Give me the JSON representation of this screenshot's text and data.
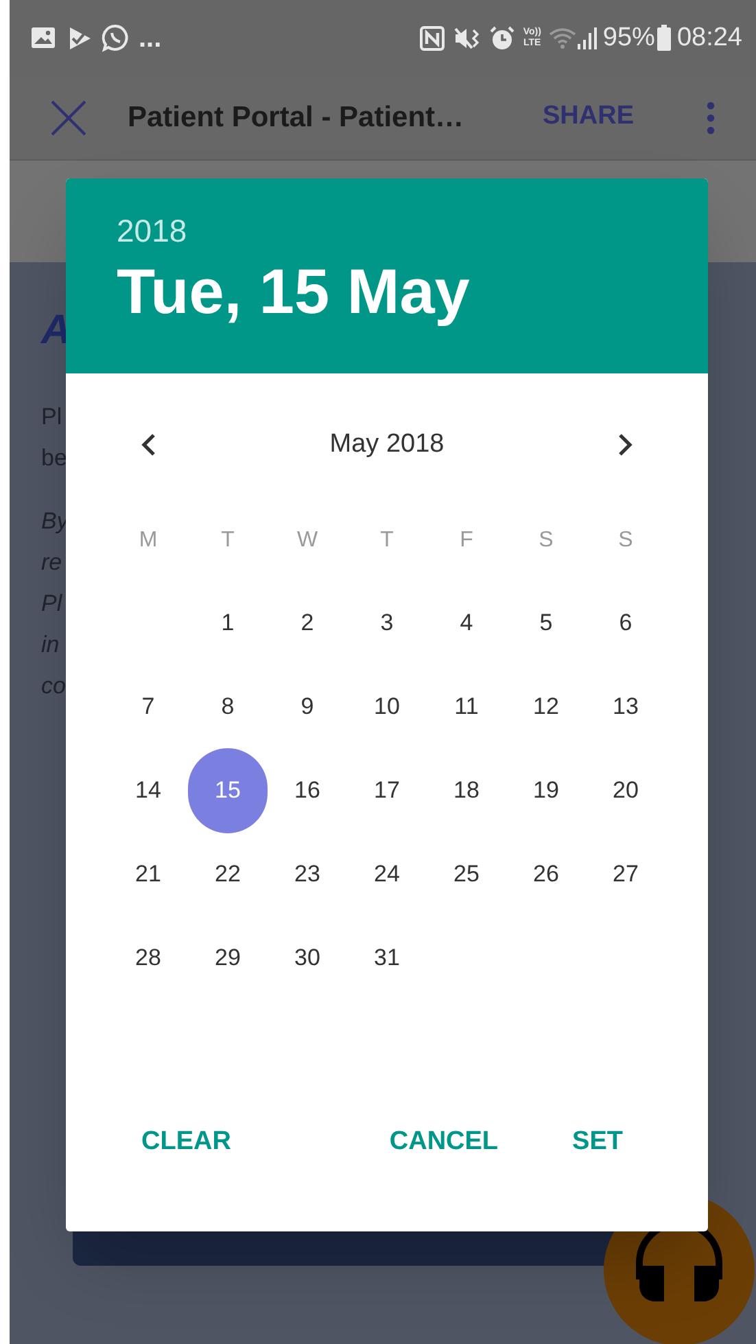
{
  "status_bar": {
    "overflow": "...",
    "network_label": [
      "Vo))",
      "LTE"
    ],
    "battery": "95%",
    "time": "08:24"
  },
  "toolbar": {
    "title": "Patient Portal - Patient…",
    "action": "SHARE"
  },
  "page": {
    "heading": "A",
    "paragraph": [
      "Pl",
      "be"
    ],
    "italic_paragraph": [
      "By",
      "re",
      "Pl",
      "in",
      "co"
    ]
  },
  "date_picker": {
    "year": "2018",
    "date": "Tue, 15 May",
    "month": "May 2018",
    "weekdays": [
      "M",
      "T",
      "W",
      "T",
      "F",
      "S",
      "S"
    ],
    "weeks": [
      [
        {
          "label": "1",
          "selected": false
        },
        {
          "label": "2",
          "selected": false
        },
        {
          "label": "3",
          "selected": false
        },
        {
          "label": "4",
          "selected": false
        },
        {
          "label": "5",
          "selected": false
        },
        {
          "label": "6",
          "selected": false
        }
      ],
      [
        {
          "label": "7",
          "selected": false
        },
        {
          "label": "8",
          "selected": false
        },
        {
          "label": "9",
          "selected": false
        },
        {
          "label": "10",
          "selected": false
        },
        {
          "label": "11",
          "selected": false
        },
        {
          "label": "12",
          "selected": false
        },
        {
          "label": "13",
          "selected": false
        }
      ],
      [
        {
          "label": "14",
          "selected": false
        },
        {
          "label": "15",
          "selected": true
        },
        {
          "label": "16",
          "selected": false
        },
        {
          "label": "17",
          "selected": false
        },
        {
          "label": "18",
          "selected": false
        },
        {
          "label": "19",
          "selected": false
        },
        {
          "label": "20",
          "selected": false
        }
      ],
      [
        {
          "label": "21",
          "selected": false
        },
        {
          "label": "22",
          "selected": false
        },
        {
          "label": "23",
          "selected": false
        },
        {
          "label": "24",
          "selected": false
        },
        {
          "label": "25",
          "selected": false
        },
        {
          "label": "26",
          "selected": false
        },
        {
          "label": "27",
          "selected": false
        }
      ],
      [
        {
          "label": "28",
          "selected": false
        },
        {
          "label": "29",
          "selected": false
        },
        {
          "label": "30",
          "selected": false
        },
        {
          "label": "31",
          "selected": false
        }
      ]
    ],
    "buttons": [
      {
        "label": "CLEAR",
        "kind": "left"
      },
      {
        "label": "CANCEL",
        "kind": "right"
      },
      {
        "label": "SET",
        "kind": "right"
      }
    ]
  }
}
